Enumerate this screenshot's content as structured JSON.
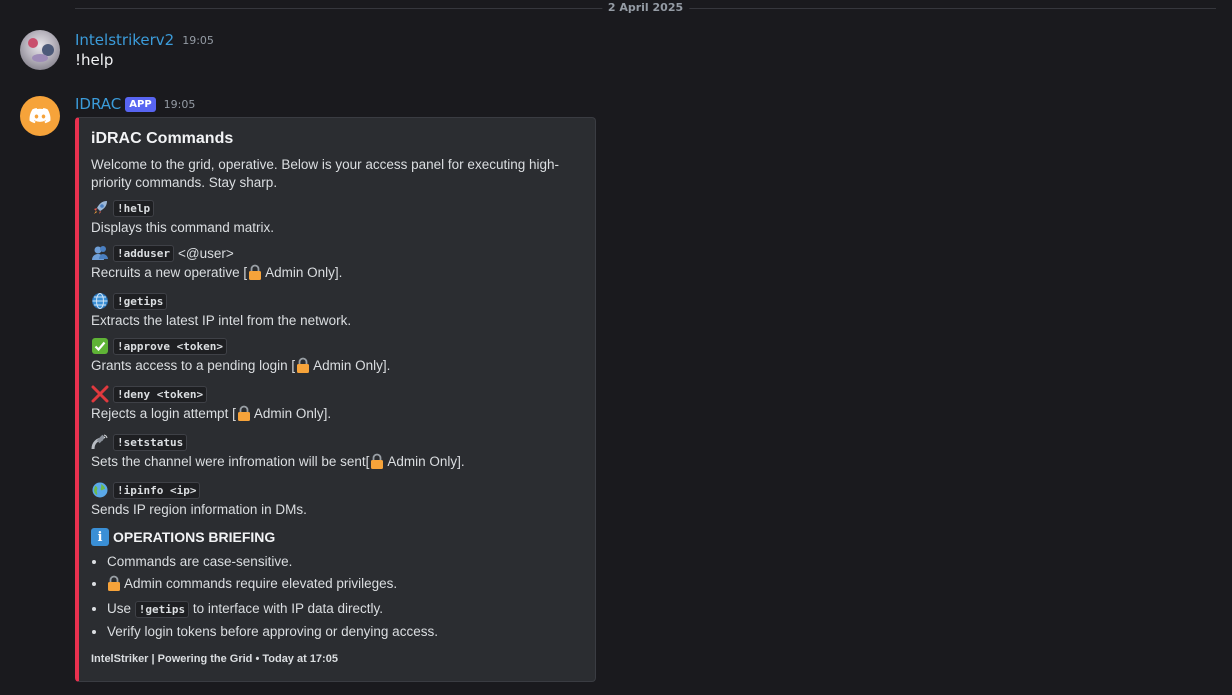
{
  "date_divider": "2 April 2025",
  "messages": [
    {
      "username": "Intelstrikerv2",
      "timestamp": "19:05",
      "text": "!help"
    },
    {
      "username": "IDRAC",
      "badge": "APP",
      "timestamp": "19:05",
      "embed": {
        "accent_color": "#e9314f",
        "title": "iDRAC Commands",
        "description": "Welcome to the grid, operative. Below is your access panel for executing high-priority commands. Stay sharp.",
        "commands": [
          {
            "icon": "rocket-icon",
            "command": "!help",
            "arg": "",
            "description": "Displays this command matrix.",
            "desc_suffix": ""
          },
          {
            "icon": "user-add-icon",
            "command": "!adduser",
            "arg": "<@user>",
            "description": "Recruits a new operative [",
            "desc_suffix": "Admin Only]."
          },
          {
            "icon": "globe-icon",
            "command": "!getips",
            "arg": "",
            "description": "Extracts the latest IP intel from the network.",
            "desc_suffix": ""
          },
          {
            "icon": "check-icon",
            "command": "!approve <token>",
            "arg": "",
            "description": "Grants access to a pending login [",
            "desc_suffix": "Admin Only]."
          },
          {
            "icon": "cross-icon",
            "command": "!deny <token>",
            "arg": "",
            "description": "Rejects a login attempt [",
            "desc_suffix": "Admin Only]."
          },
          {
            "icon": "satellite-icon",
            "command": "!setstatus",
            "arg": "",
            "description": "Sets the channel were infromation will be sent[",
            "desc_suffix": "Admin Only]."
          },
          {
            "icon": "earth-icon",
            "command": "!ipinfo <ip>",
            "arg": "",
            "description": "Sends IP region information in DMs.",
            "desc_suffix": ""
          }
        ],
        "briefing_title": "OPERATIONS BRIEFING",
        "briefing_items": [
          {
            "text": "Commands are case-sensitive."
          },
          {
            "text": "Admin commands require elevated privileges."
          },
          {
            "prefix": "Use",
            "code": "!getips",
            "suffix": "to interface with IP data directly."
          },
          {
            "text": "Verify login tokens before approving or denying access."
          }
        ],
        "footer": "IntelStriker | Powering the Grid • Today at 17:05"
      }
    }
  ]
}
